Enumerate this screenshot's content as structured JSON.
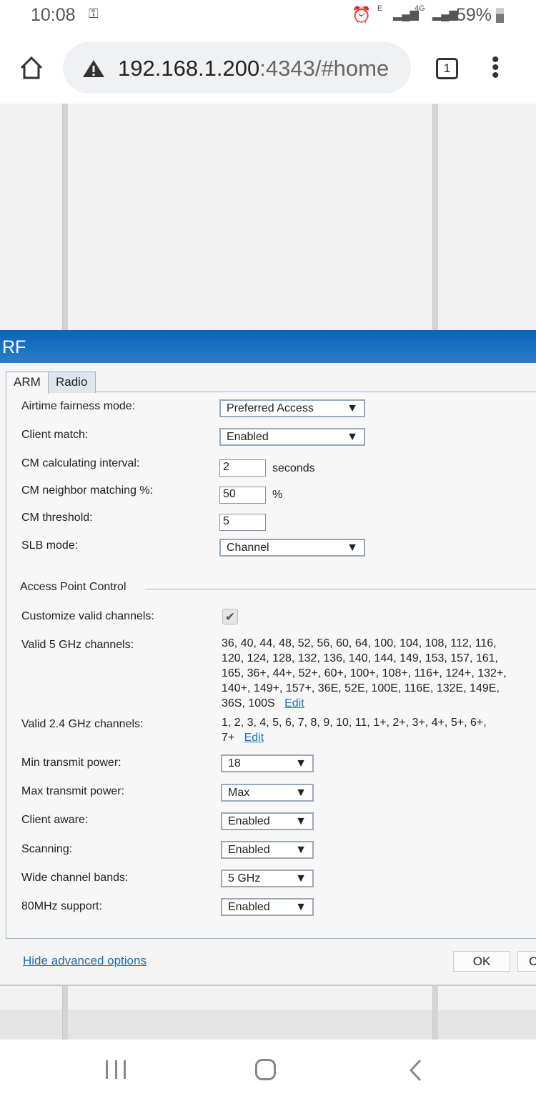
{
  "status_bar": {
    "time": "10:08",
    "network_e": "E",
    "network_4g": "4G",
    "battery": "59%"
  },
  "browser": {
    "url_host": "192.168.1.200",
    "url_rest": ":4343/#home",
    "tab_count": "1"
  },
  "dialog": {
    "title": "RF",
    "tabs": [
      {
        "label": "ARM",
        "active": true
      },
      {
        "label": "Radio",
        "active": false
      }
    ],
    "fields": {
      "airtime_fairness": {
        "label": "Airtime fairness mode:",
        "value": "Preferred Access"
      },
      "client_match": {
        "label": "Client match:",
        "value": "Enabled"
      },
      "cm_interval": {
        "label": "CM calculating interval:",
        "value": "2",
        "unit": "seconds"
      },
      "cm_neighbor": {
        "label": "CM neighbor matching %:",
        "value": "50",
        "unit": "%"
      },
      "cm_threshold": {
        "label": "CM threshold:",
        "value": "5"
      },
      "slb_mode": {
        "label": "SLB mode:",
        "value": "Channel"
      }
    },
    "section_title": "Access Point Control",
    "ap": {
      "customize": {
        "label": "Customize valid channels:",
        "checked": true
      },
      "valid_5": {
        "label": "Valid 5 GHz channels:",
        "value": "36, 40, 44, 48, 52, 56, 60, 64, 100, 104, 108, 112, 116, 120, 124, 128, 132, 136, 140, 144, 149, 153, 157, 161, 165, 36+, 44+, 52+, 60+, 100+, 108+, 116+, 124+, 132+, 140+, 149+, 157+, 36E, 52E, 100E, 116E, 132E, 149E, 36S, 100S",
        "edit": "Edit"
      },
      "valid_24": {
        "label": "Valid 2.4 GHz channels:",
        "value": "1, 2, 3, 4, 5, 6, 7, 8, 9, 10, 11, 1+, 2+, 3+, 4+, 5+, 6+, 7+",
        "edit": "Edit"
      },
      "min_power": {
        "label": "Min transmit power:",
        "value": "18"
      },
      "max_power": {
        "label": "Max transmit power:",
        "value": "Max"
      },
      "client_aware": {
        "label": "Client aware:",
        "value": "Enabled"
      },
      "scanning": {
        "label": "Scanning:",
        "value": "Enabled"
      },
      "wide_bands": {
        "label": "Wide channel bands:",
        "value": "5 GHz"
      },
      "mhz80": {
        "label": "80MHz support:",
        "value": "Enabled"
      }
    },
    "hide_advanced": "Hide advanced options",
    "ok": "OK",
    "cancel_partial": "C"
  },
  "colors": {
    "header_blue": "#0a63bd",
    "link": "#1a73c8"
  }
}
